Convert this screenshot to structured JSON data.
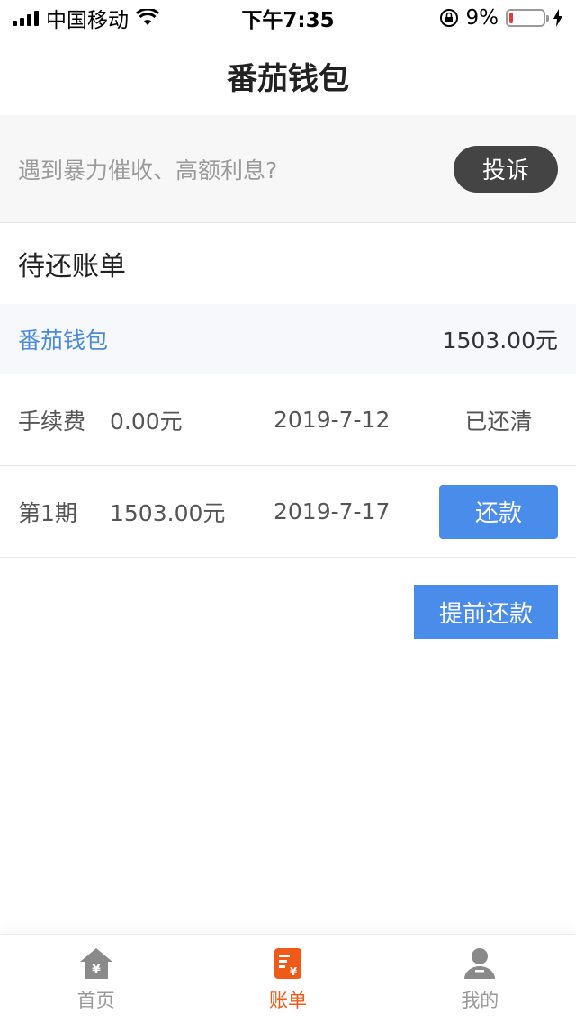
{
  "status_bar": {
    "carrier": "中国移动",
    "time": "下午7:35",
    "battery_percent": "9%"
  },
  "nav": {
    "title": "番茄钱包"
  },
  "notice": {
    "text": "遇到暴力催收、高额利息?",
    "button_label": "投诉"
  },
  "section": {
    "title": "待还账单"
  },
  "product": {
    "name": "番茄钱包",
    "amount": "1503.00元"
  },
  "bills": [
    {
      "label": "手续费",
      "amount": "0.00元",
      "date": "2019-7-12",
      "status": "已还清"
    },
    {
      "label": "第1期",
      "amount": "1503.00元",
      "date": "2019-7-17",
      "action": "还款"
    }
  ],
  "early_repay": {
    "label": "提前还款"
  },
  "tabs": [
    {
      "label": "首页",
      "icon": "home-yuan-icon"
    },
    {
      "label": "账单",
      "icon": "bill-icon"
    },
    {
      "label": "我的",
      "icon": "user-icon"
    }
  ],
  "colors": {
    "accent_blue": "#4a8cea",
    "link_blue": "#4a8ad9",
    "active_orange": "#f05a18",
    "dark_button": "#444444",
    "battery_red": "#e53935"
  }
}
